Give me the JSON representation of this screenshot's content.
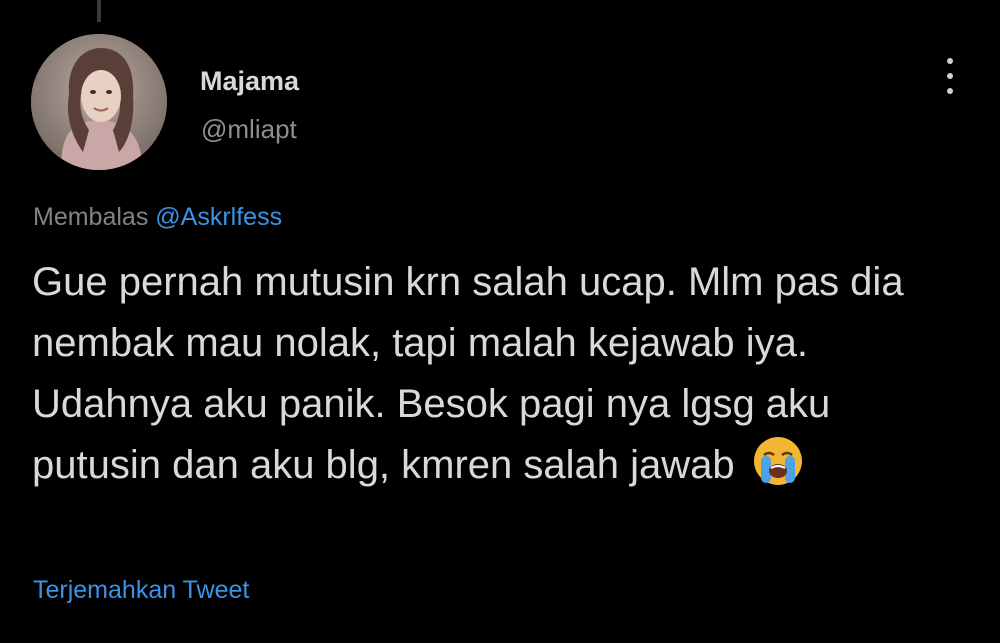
{
  "user": {
    "display_name": "Majama",
    "handle": "@mliapt"
  },
  "reply": {
    "prefix": "Membalas",
    "mention": "@Askrlfess"
  },
  "tweet": {
    "text": "Gue pernah mutusin krn salah ucap. Mlm pas dia nembak mau nolak, tapi malah kejawab iya. Udahnya aku panik. Besok pagi nya lgsg aku putusin dan aku blg, kmren salah jawab",
    "emoji": "loudly-crying-face-emoji"
  },
  "actions": {
    "translate_label": "Terjemahkan Tweet",
    "more_icon": "more-vertical-icon"
  },
  "colors": {
    "background": "#000000",
    "text": "#d9d9d9",
    "muted": "#8b8f94",
    "link": "#3a93e6"
  }
}
